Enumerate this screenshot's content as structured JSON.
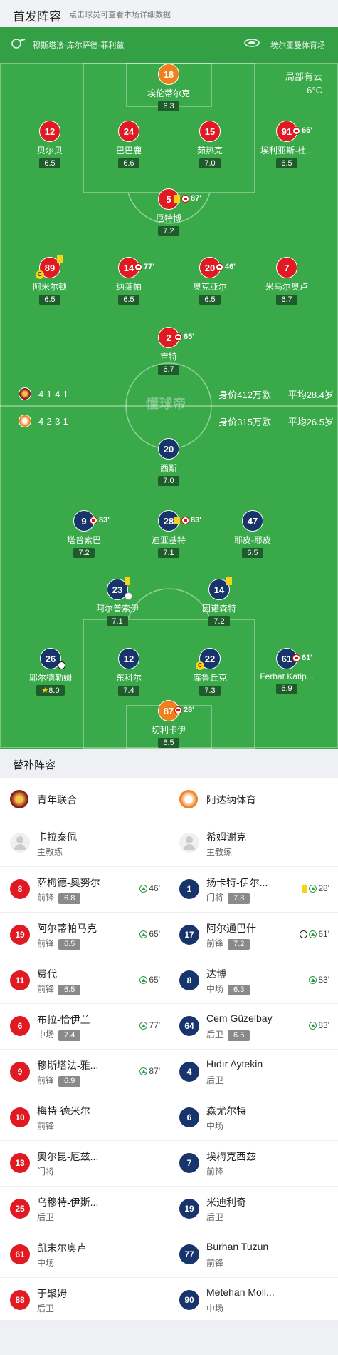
{
  "header": {
    "title": "首发阵容",
    "hint": "点击球员可查看本场详细数据"
  },
  "match": {
    "referee": "穆斯塔法-库尔萨德-菲利兹",
    "stadium": "埃尔亚曼体育场",
    "weather": "局部有云",
    "temp": "6°C"
  },
  "home_team": {
    "name": "青年联合",
    "formation": "4-1-4-1",
    "value": "身价412万欧",
    "avg_age": "平均28.4岁"
  },
  "away_team": {
    "name": "阿达纳体育",
    "formation": "4-2-3-1",
    "value": "身价315万欧",
    "avg_age": "平均26.5岁"
  },
  "watermark": "懂球帝",
  "home_players": [
    {
      "num": "18",
      "name": "埃伦蒂尔克",
      "rating": "6.3"
    },
    {
      "num": "12",
      "name": "贝尔贝",
      "rating": "6.5"
    },
    {
      "num": "24",
      "name": "巴巴鹿",
      "rating": "6.6"
    },
    {
      "num": "15",
      "name": "茹热克",
      "rating": "7.0"
    },
    {
      "num": "91",
      "name": "埃利亚斯-杜...",
      "rating": "6.5",
      "sub": "65'"
    },
    {
      "num": "5",
      "name": "厄特博",
      "rating": "7.2",
      "sub": "87'",
      "yellow": true
    },
    {
      "num": "89",
      "name": "阿米尔顿",
      "rating": "6.5",
      "yellow": true,
      "captain": "C"
    },
    {
      "num": "14",
      "name": "纳莱帕",
      "rating": "6.5",
      "sub": "77'"
    },
    {
      "num": "20",
      "name": "奥克亚尔",
      "rating": "6.5",
      "sub": "46'"
    },
    {
      "num": "7",
      "name": "米马尔奥卢",
      "rating": "6.7"
    },
    {
      "num": "2",
      "name": "吉特",
      "rating": "6.7",
      "sub": "65'"
    }
  ],
  "away_players": [
    {
      "num": "20",
      "name": "西斯",
      "rating": "7.0"
    },
    {
      "num": "9",
      "name": "塔普索巴",
      "rating": "7.2",
      "sub": "83'"
    },
    {
      "num": "28",
      "name": "迪亚基特",
      "rating": "7.1",
      "sub": "83'",
      "yellow": true
    },
    {
      "num": "47",
      "name": "耶皮-耶皮",
      "rating": "6.5"
    },
    {
      "num": "23",
      "name": "阿尔普索伊",
      "rating": "7.1",
      "yellow": true
    },
    {
      "num": "14",
      "name": "因诺森特",
      "rating": "7.2",
      "yellow": true
    },
    {
      "num": "26",
      "name": "耶尔德勒姆",
      "rating": "8.0"
    },
    {
      "num": "12",
      "name": "东科尔",
      "rating": "7.4"
    },
    {
      "num": "22",
      "name": "库鲁丘克",
      "rating": "7.3",
      "captain": "C"
    },
    {
      "num": "61",
      "name": "Ferhat Katip...",
      "rating": "6.9",
      "sub": "61'"
    },
    {
      "num": "87",
      "name": "切利卡伊",
      "rating": "6.5",
      "sub": "28'"
    }
  ],
  "subs_title": "替补阵容",
  "home_coach": {
    "name": "卡拉泰佩",
    "role": "主教练"
  },
  "away_coach": {
    "name": "希姆谢克",
    "role": "主教练"
  },
  "home_subs": [
    {
      "num": "8",
      "name": "萨梅德-奥努尔",
      "pos": "前锋",
      "rating": "6.8",
      "min": "46'"
    },
    {
      "num": "19",
      "name": "阿尔蒂帕马克",
      "pos": "前锋",
      "rating": "6.5",
      "min": "65'"
    },
    {
      "num": "11",
      "name": "费代",
      "pos": "前锋",
      "rating": "6.5",
      "min": "65'"
    },
    {
      "num": "6",
      "name": "布拉-恰伊兰",
      "pos": "中场",
      "rating": "7.4",
      "min": "77'"
    },
    {
      "num": "9",
      "name": "穆斯塔法-雅...",
      "pos": "前锋",
      "rating": "6.9",
      "min": "87'"
    },
    {
      "num": "10",
      "name": "梅特-德米尔",
      "pos": "前锋"
    },
    {
      "num": "13",
      "name": "奥尔昆-厄兹...",
      "pos": "门将"
    },
    {
      "num": "25",
      "name": "乌穆特-伊斯...",
      "pos": "后卫"
    },
    {
      "num": "61",
      "name": "凯末尔奥卢",
      "pos": "中场"
    },
    {
      "num": "88",
      "name": "于聚姆",
      "pos": "后卫"
    }
  ],
  "away_subs": [
    {
      "num": "1",
      "name": "扬卡特-伊尔...",
      "pos": "门将",
      "rating": "7.8",
      "min": "28'",
      "yellow": true
    },
    {
      "num": "17",
      "name": "阿尔通巴什",
      "pos": "前锋",
      "rating": "7.2",
      "min": "61'",
      "goal": true
    },
    {
      "num": "8",
      "name": "达博",
      "pos": "中场",
      "rating": "6.3",
      "min": "83'"
    },
    {
      "num": "64",
      "name": "Cem Güzelbay",
      "pos": "后卫",
      "rating": "6.5",
      "min": "83'"
    },
    {
      "num": "4",
      "name": "Hıdır Aytekin",
      "pos": "后卫"
    },
    {
      "num": "6",
      "name": "森尤尔特",
      "pos": "中场"
    },
    {
      "num": "7",
      "name": "埃梅克西兹",
      "pos": "前锋"
    },
    {
      "num": "19",
      "name": "米迪利奇",
      "pos": "后卫"
    },
    {
      "num": "77",
      "name": "Burhan Tuzun",
      "pos": "前锋"
    },
    {
      "num": "90",
      "name": "Metehan Moll...",
      "pos": "中场"
    }
  ],
  "colors": {
    "pitch": "#3aa94a",
    "home": "#e01a22",
    "away": "#17346b",
    "away_gk": "#f07f1d"
  }
}
